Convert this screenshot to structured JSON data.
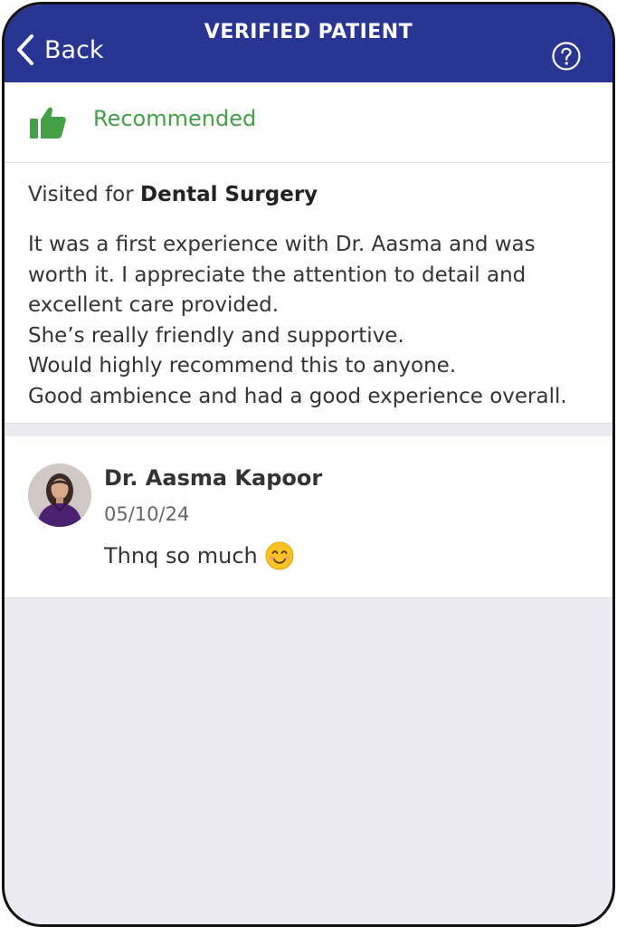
{
  "header": {
    "back_label": "Back",
    "title": "VERIFIED PATIENT"
  },
  "recommendation": {
    "label": "Recommended"
  },
  "review": {
    "visited_prefix": "Visited for",
    "visited_for": "Dental Surgery",
    "lines": [
      "It was a first experience with Dr. Aasma and was",
      "worth it. I appreciate the attention to detail and",
      "excellent care provided.",
      "She’s really friendly and supportive.",
      "Would highly recommend this to anyone.",
      "Good ambience and had a good experience overall."
    ]
  },
  "reply": {
    "doctor_name": "Dr. Aasma Kapoor",
    "date": "05/10/24",
    "text": "Thnq so much"
  },
  "colors": {
    "header_bg": "#283593",
    "recommended_green": "#43a047",
    "page_bg": "#ecebf1"
  },
  "icons": {
    "back": "chevron-left-icon",
    "help": "question-circle-icon",
    "recommend": "thumbs-up-icon",
    "emoji": "smiling-face-emoji"
  }
}
